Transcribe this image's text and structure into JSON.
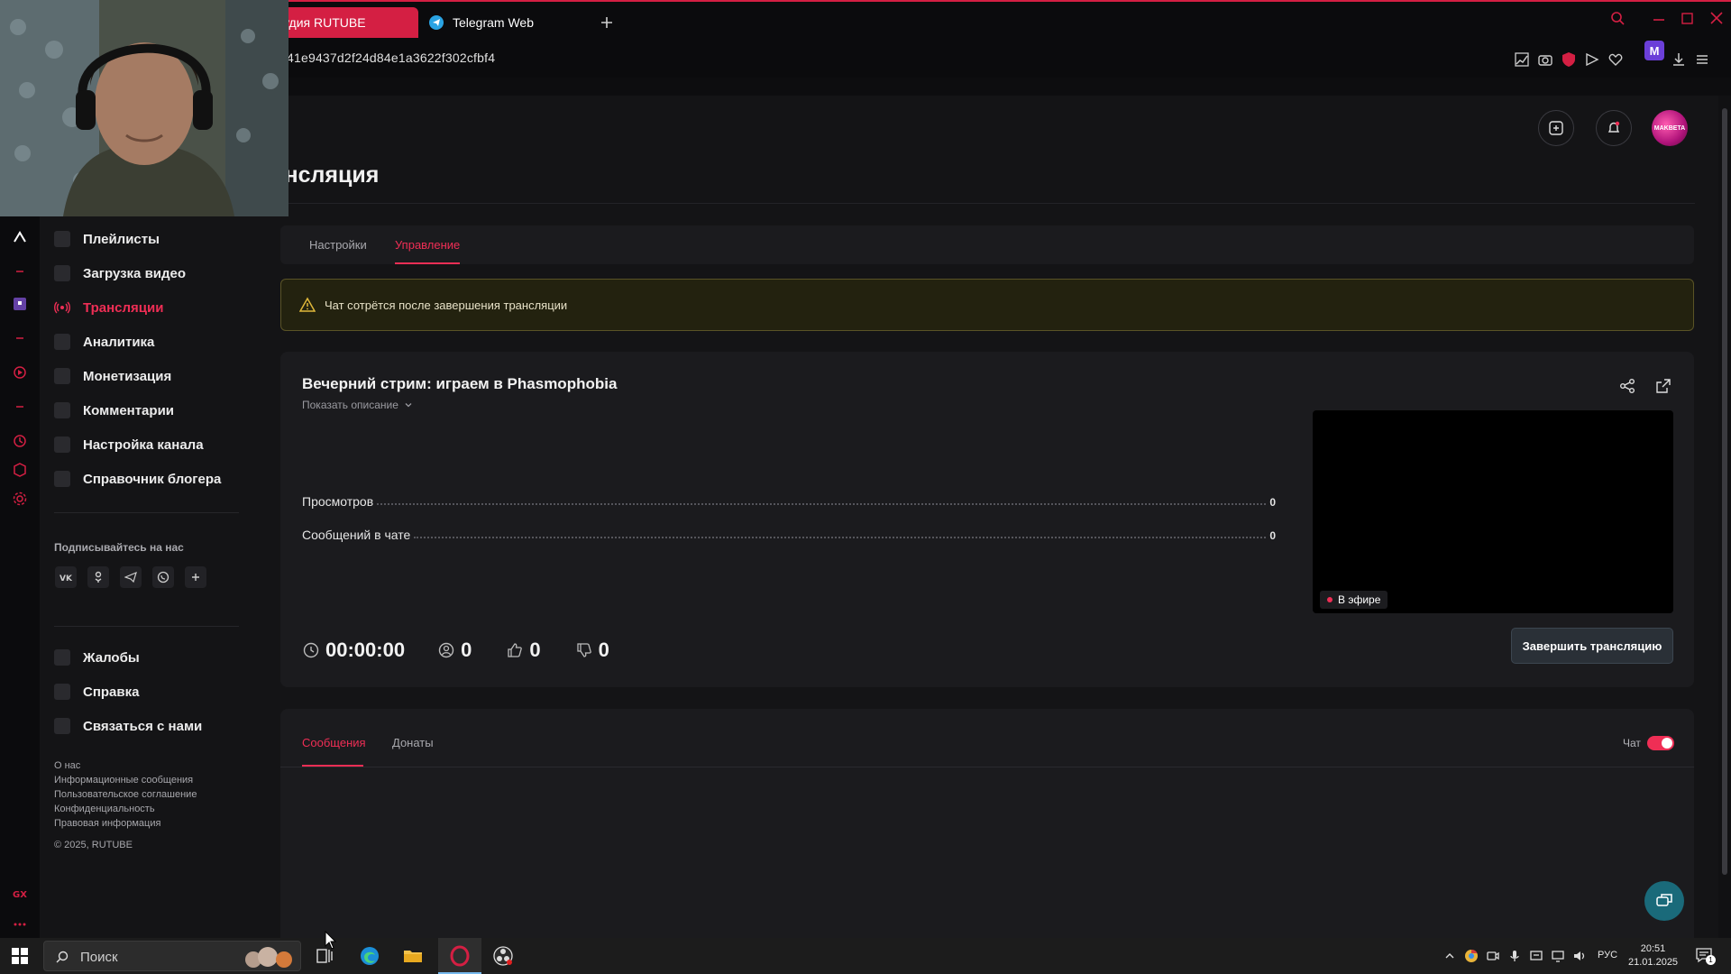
{
  "browser": {
    "tabs": [
      {
        "label": "удия RUTUBE"
      },
      {
        "label": "Telegram Web"
      }
    ],
    "url": "41e9437d2f24d84e1a3622f302cfbf4",
    "ext_m": "M"
  },
  "colors": {
    "accent": "#ef2e55",
    "tab_active": "#d41f43",
    "warning_bg": "#23220f"
  },
  "header": {
    "title": "Трансляция",
    "avatar_text": "MAKBETA"
  },
  "sidebar": {
    "items": [
      {
        "label": "Плейлисты",
        "icon": "playlist-icon"
      },
      {
        "label": "Загрузка видео",
        "icon": "upload-icon"
      },
      {
        "label": "Трансляции",
        "icon": "broadcast-icon",
        "active": true
      },
      {
        "label": "Аналитика",
        "icon": "analytics-icon"
      },
      {
        "label": "Монетизация",
        "icon": "monetization-icon"
      },
      {
        "label": "Комментарии",
        "icon": "comments-icon"
      },
      {
        "label": "Настройка канала",
        "icon": "channel-settings-icon"
      },
      {
        "label": "Справочник блогера",
        "icon": "guide-icon"
      }
    ],
    "follow_label": "Подписывайтесь на нас",
    "socials": [
      "vk-icon",
      "ok-icon",
      "telegram-icon",
      "viber-icon",
      "plus-icon"
    ],
    "support_items": [
      {
        "label": "Жалобы",
        "icon": "flag-icon"
      },
      {
        "label": "Справка",
        "icon": "help-icon"
      },
      {
        "label": "Связаться с нами",
        "icon": "mail-icon"
      }
    ],
    "footer_links": [
      "О нас",
      "Информационные сообщения",
      "Пользовательское соглашение",
      "Конфиденциальность",
      "Правовая информация"
    ],
    "copyright": "© 2025, RUTUBE"
  },
  "tabs": [
    {
      "label": "Настройки"
    },
    {
      "label": "Управление",
      "active": true
    }
  ],
  "warning": "Чат сотрётся после завершения трансляции",
  "stream": {
    "title": "Вечерний стрим: играем в Phasmophobia",
    "show_description": "Показать описание",
    "stats": [
      {
        "label": "Просмотров",
        "value": "0"
      },
      {
        "label": "Сообщений в чате",
        "value": "0"
      }
    ],
    "live_label": "В эфире",
    "timer": "00:00:00",
    "viewers": "0",
    "likes": "0",
    "dislikes": "0",
    "end_button": "Завершить трансляцию"
  },
  "chat": {
    "tabs": [
      {
        "label": "Сообщения",
        "active": true
      },
      {
        "label": "Донаты"
      }
    ],
    "toggle_label": "Чат",
    "toggle_on": true
  },
  "taskbar": {
    "search_placeholder": "Поиск",
    "lang": "РУС",
    "time": "20:51",
    "date": "21.01.2025",
    "notifications": "1"
  }
}
